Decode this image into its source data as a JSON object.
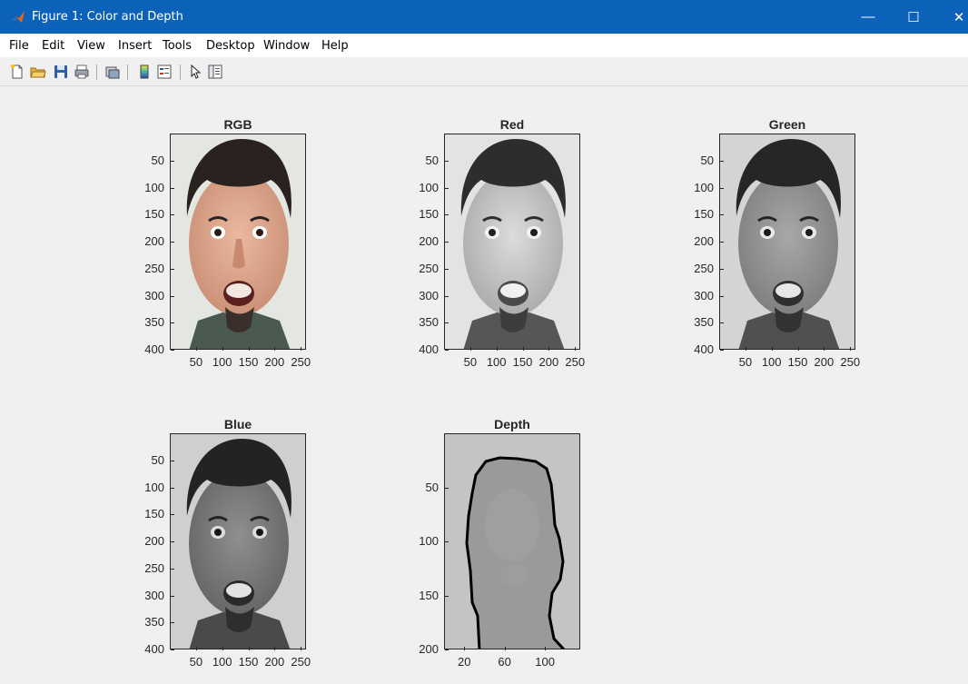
{
  "window": {
    "title": "Figure 1: Color and Depth",
    "minimize_glyph": "—",
    "maximize_glyph": "☐",
    "close_glyph": "✕"
  },
  "menu": {
    "items": [
      "File",
      "Edit",
      "View",
      "Insert",
      "Tools",
      "Desktop",
      "Window",
      "Help"
    ]
  },
  "toolbar": {
    "buttons": [
      "new-figure-icon",
      "open-file-icon",
      "save-icon",
      "print-icon",
      "link-plot-icon",
      "insert-colorbar-icon",
      "insert-legend-icon",
      "edit-plot-arrow-icon",
      "property-inspector-icon"
    ]
  },
  "subplots": {
    "rgb": {
      "title": "RGB",
      "yticks": [
        "50",
        "100",
        "150",
        "200",
        "250",
        "300",
        "350",
        "400"
      ],
      "xticks": [
        "50",
        "100",
        "150",
        "200",
        "250"
      ]
    },
    "red": {
      "title": "Red",
      "yticks": [
        "50",
        "100",
        "150",
        "200",
        "250",
        "300",
        "350",
        "400"
      ],
      "xticks": [
        "50",
        "100",
        "150",
        "200",
        "250"
      ]
    },
    "green": {
      "title": "Green",
      "yticks": [
        "50",
        "100",
        "150",
        "200",
        "250",
        "300",
        "350",
        "400"
      ],
      "xticks": [
        "50",
        "100",
        "150",
        "200",
        "250"
      ]
    },
    "blue": {
      "title": "Blue",
      "yticks": [
        "50",
        "100",
        "150",
        "200",
        "250",
        "300",
        "350",
        "400"
      ],
      "xticks": [
        "50",
        "100",
        "150",
        "200",
        "250"
      ]
    },
    "depth": {
      "title": "Depth",
      "yticks": [
        "50",
        "100",
        "150",
        "200"
      ],
      "xticks": [
        "20",
        "60",
        "100"
      ]
    }
  },
  "colors": {
    "titlebar": "#0c62b8",
    "figure_bg": "#f0f0f0",
    "axis_text": "#262626"
  }
}
